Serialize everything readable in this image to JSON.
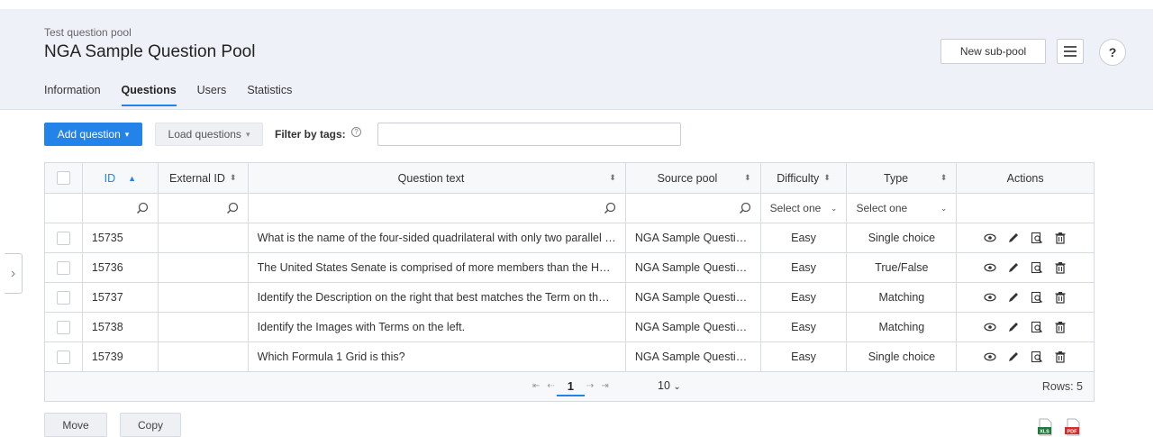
{
  "header": {
    "subtitle": "Test question pool",
    "title": "NGA Sample Question Pool",
    "new_subpool_label": "New sub-pool",
    "help_label": "?"
  },
  "tabs": [
    {
      "label": "Information",
      "active": false
    },
    {
      "label": "Questions",
      "active": true
    },
    {
      "label": "Users",
      "active": false
    },
    {
      "label": "Statistics",
      "active": false
    }
  ],
  "toolbar": {
    "add_question_label": "Add question",
    "load_questions_label": "Load questions",
    "filter_label": "Filter by tags:",
    "filter_value": ""
  },
  "table": {
    "columns": {
      "id": "ID",
      "external_id": "External ID",
      "question_text": "Question text",
      "source_pool": "Source pool",
      "difficulty": "Difficulty",
      "type": "Type",
      "actions": "Actions"
    },
    "filters": {
      "difficulty_select": "Select one",
      "type_select": "Select one"
    },
    "rows": [
      {
        "id": "15735",
        "external_id": "",
        "text": "What is the name of the four-sided quadrilateral with only two parallel …",
        "source": "NGA Sample Question…",
        "difficulty": "Easy",
        "type": "Single choice"
      },
      {
        "id": "15736",
        "external_id": "",
        "text": "The United States Senate is comprised of more members than the Ho…",
        "source": "NGA Sample Question…",
        "difficulty": "Easy",
        "type": "True/False"
      },
      {
        "id": "15737",
        "external_id": "",
        "text": "Identify the Description on the right that best matches the Term on th…",
        "source": "NGA Sample Question…",
        "difficulty": "Easy",
        "type": "Matching"
      },
      {
        "id": "15738",
        "external_id": "",
        "text": "Identify the Images with Terms on the left.",
        "source": "NGA Sample Question…",
        "difficulty": "Easy",
        "type": "Matching"
      },
      {
        "id": "15739",
        "external_id": "",
        "text": "Which Formula 1 Grid is this?",
        "source": "NGA Sample Question…",
        "difficulty": "Easy",
        "type": "Single choice"
      }
    ],
    "pagination": {
      "current_page": "1",
      "page_size": "10",
      "rows_label": "Rows: 5"
    }
  },
  "bottom": {
    "move_label": "Move",
    "copy_label": "Copy",
    "xls_label": "XLS",
    "pdf_label": "PDF"
  },
  "colors": {
    "accent": "#2383e8",
    "header_bg": "#eef2f8"
  }
}
